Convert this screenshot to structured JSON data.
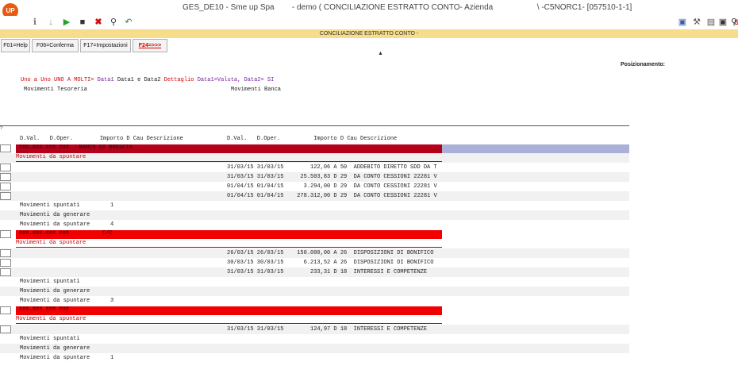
{
  "window": {
    "logo": "UP",
    "title": "GES_DE10 - Sme up Spa        - demo ( CONCILIAZIONE ESTRATTO CONTO- Azienda                    \\ -C5NORC1- [057510-1-1]"
  },
  "toolbar": {
    "left_icons": [
      "info-icon",
      "arrow-down-icon",
      "play-icon",
      "stop-icon",
      "delete-icon",
      "find-icon",
      "undo-icon"
    ],
    "right_icons": [
      "monitor-icon",
      "tools-icon",
      "document-icon",
      "lock-icon",
      "search-icon",
      "signal-icon"
    ],
    "right_text": "Sr"
  },
  "banner": {
    "label": "CONCILIAZIONE ESTRATTO CONTO -"
  },
  "function_keys": [
    {
      "label": "F01=Help"
    },
    {
      "label": "F06=Conferma"
    },
    {
      "label": "F17=Impostazioni"
    },
    {
      "label": "F24=>>>"
    }
  ],
  "caret": "▲",
  "positioning_label": "Posizionamento:",
  "mode_line": {
    "uno": "Uno a Uno",
    "molti": "UNO A MOLTI=",
    "data1": "Data1",
    "data1b": "Data1 e Data2",
    "dettaglio": "Dettaglio",
    "valuta": "Data1=Valuta, Data2=",
    "si": "SI"
  },
  "headers": {
    "left": "Movimenti Tesoreria",
    "right": "Movimenti Banca"
  },
  "question_mark": "?",
  "columns": {
    "left": "D.Val.   D.Oper.        Importo D Cau Descrizione",
    "right": "D.Val.   D.Oper.          Importo D Cau Descrizione"
  },
  "sections": [
    {
      "band_label": "###.###.### ###   BANCO DI BRESCIA",
      "to_reconcile": "Movimenti da spuntare",
      "bank_rows": [
        "31/03/15 31/03/15        122,06 A 50  ADDEBITO DIRETTO SDD DA T",
        "31/03/15 31/03/15     25.503,83 D 29  DA CONTO CESSIONI 22281 V",
        "01/04/15 01/04/15      3.294,00 D 29  DA CONTO CESSIONI 22281 V",
        "01/04/15 01/04/15    278.312,00 D 29  DA CONTO CESSIONI 22281 V"
      ],
      "summary": [
        {
          "label": "Movimenti spuntati",
          "value": "1"
        },
        {
          "label": "Movimenti da generare",
          "value": ""
        },
        {
          "label": "Movimenti da spuntare",
          "value": "4"
        }
      ]
    },
    {
      "band_label": "###.###.### ###          C/C",
      "to_reconcile": "Movimenti da spuntare",
      "bank_rows": [
        "26/03/15 26/03/15    150.000,00 A 26  DISPOSIZIONI DI BONIFICO",
        "30/03/15 30/03/15      6.213,52 A 26  DISPOSIZIONI DI BONIFICO",
        "31/03/15 31/03/15        233,31 D 18  INTERESSI E COMPETENZE"
      ],
      "summary": [
        {
          "label": "Movimenti spuntati",
          "value": ""
        },
        {
          "label": "Movimenti da generare",
          "value": ""
        },
        {
          "label": "Movimenti da spuntare",
          "value": "3"
        }
      ]
    },
    {
      "band_label": "###.###.### ###",
      "to_reconcile": "Movimenti da spuntare",
      "bank_rows": [
        "31/03/15 31/03/15        124,97 D 18  INTERESSI E COMPETENZE"
      ],
      "summary": [
        {
          "label": "Movimenti spuntati",
          "value": ""
        },
        {
          "label": "Movimenti da generare",
          "value": ""
        },
        {
          "label": "Movimenti da spuntare",
          "value": "1"
        }
      ]
    }
  ],
  "colors": {
    "band_dark": "#b3001b",
    "band_bright": "#f00000",
    "banner": "#f7dc8a",
    "stripe": "#f1f1f1",
    "lavender": "#aab0d8"
  }
}
